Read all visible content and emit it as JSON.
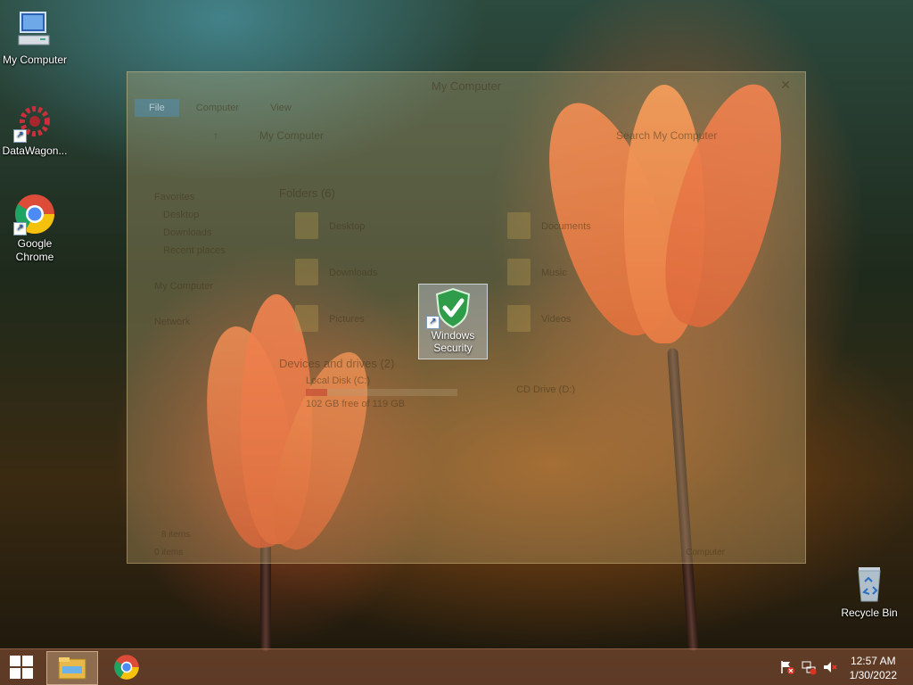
{
  "desktop": {
    "icons": [
      {
        "label": "My Computer"
      },
      {
        "label": "DataWagon..."
      },
      {
        "label": "Google Chrome"
      },
      {
        "label": "Windows Security"
      },
      {
        "label": "Recycle Bin"
      }
    ]
  },
  "explorer": {
    "title": "My Computer",
    "tabs": [
      "File",
      "Computer",
      "View"
    ],
    "breadcrumb": "My Computer",
    "search_placeholder": "Search My Computer",
    "nav": {
      "favorites": "Favorites",
      "favorites_items": [
        "Desktop",
        "Downloads",
        "Recent places"
      ],
      "computer": "My Computer",
      "network": "Network"
    },
    "folders_header": "Folders (6)",
    "folders": [
      "Desktop",
      "Documents",
      "Downloads",
      "Music",
      "Pictures",
      "Videos"
    ],
    "drives_header": "Devices and drives (2)",
    "drives": [
      {
        "name": "Local Disk (C:)",
        "space": "102 GB free of 119 GB",
        "fill": 0.14
      },
      {
        "name": "CD Drive (D:)"
      }
    ],
    "items_count": "8 items",
    "status_count": "0 items",
    "status_right": "Computer"
  },
  "taskbar": {
    "clock_time": "12:57 AM",
    "clock_date": "1/30/2022"
  },
  "colors": {
    "accent": "#1e5db8",
    "taskbar": "#9a5a3c"
  }
}
